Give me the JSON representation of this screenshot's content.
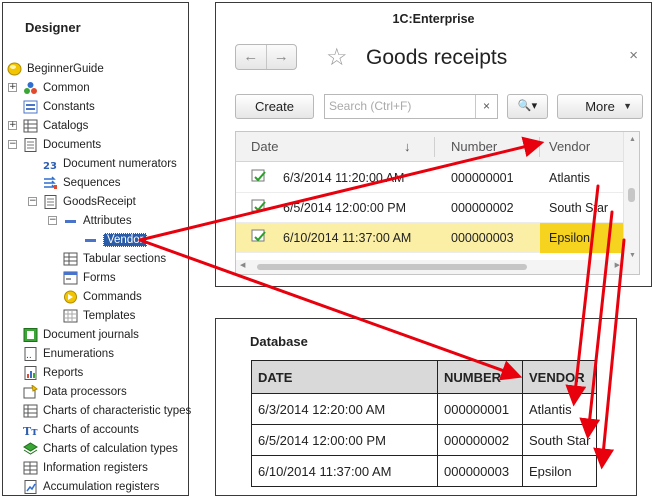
{
  "designer": {
    "title": "Designer",
    "tree": [
      {
        "label": "BeginnerGuide",
        "icon": "config-icon"
      },
      {
        "label": "Common",
        "icon": "common-icon",
        "expander": "+"
      },
      {
        "label": "Constants",
        "icon": "constants-icon"
      },
      {
        "label": "Catalogs",
        "icon": "catalogs-icon",
        "expander": "+"
      },
      {
        "label": "Documents",
        "icon": "documents-icon",
        "expander": "−"
      },
      {
        "label": "Document numerators",
        "icon": "numerator-icon"
      },
      {
        "label": "Sequences",
        "icon": "sequences-icon"
      },
      {
        "label": "GoodsReceipt",
        "icon": "document-icon",
        "expander": "−"
      },
      {
        "label": "Attributes",
        "icon": "attributes-icon",
        "expander": "−"
      },
      {
        "label": "Vendor",
        "icon": "attribute-icon"
      },
      {
        "label": "Tabular sections",
        "icon": "tabular-icon"
      },
      {
        "label": "Forms",
        "icon": "forms-icon"
      },
      {
        "label": "Commands",
        "icon": "commands-icon"
      },
      {
        "label": "Templates",
        "icon": "templates-icon"
      },
      {
        "label": "Document journals",
        "icon": "journals-icon"
      },
      {
        "label": "Enumerations",
        "icon": "enumerations-icon"
      },
      {
        "label": "Reports",
        "icon": "reports-icon"
      },
      {
        "label": "Data processors",
        "icon": "processors-icon"
      },
      {
        "label": "Charts of characteristic types",
        "icon": "char-types-icon"
      },
      {
        "label": "Charts of accounts",
        "icon": "accounts-icon"
      },
      {
        "label": "Charts of calculation types",
        "icon": "calc-types-icon"
      },
      {
        "label": "Information registers",
        "icon": "info-registers-icon"
      },
      {
        "label": "Accumulation registers",
        "icon": "accum-registers-icon"
      }
    ]
  },
  "enterprise": {
    "window_title": "1C:Enterprise",
    "form_title": "Goods receipts",
    "back_icon": "←",
    "forward_icon": "→",
    "star_icon": "☆",
    "close_icon": "×",
    "create_label": "Create",
    "search_placeholder": "Search (Ctrl+F)",
    "search_clear_icon": "×",
    "search_button_icon": "🔍▾",
    "more_label": "More",
    "more_arrow": "▼",
    "columns": {
      "date": "Date",
      "sort_icon": "↓",
      "number": "Number",
      "vendor": "Vendor"
    },
    "rows": [
      {
        "date": "6/3/2014 11:20:00 AM",
        "number": "000000001",
        "vendor": "Atlantis"
      },
      {
        "date": "6/5/2014 12:00:00 PM",
        "number": "000000002",
        "vendor": "South Star"
      },
      {
        "date": "6/10/2014 11:37:00 AM",
        "number": "000000003",
        "vendor": "Epsilon"
      }
    ],
    "colors": {
      "selected_row": "#fbefa6",
      "selected_cell": "#f6d31f"
    }
  },
  "database": {
    "title": "Database",
    "headers": [
      "DATE",
      "NUMBER",
      "VENDOR"
    ],
    "rows": [
      [
        "6/3/2014 12:20:00 AM",
        "000000001",
        "Atlantis"
      ],
      [
        "6/5/2014 12:00:00 PM",
        "000000002",
        "South Star"
      ],
      [
        "6/10/2014 11:37:00 AM",
        "000000003",
        "Epsilon"
      ]
    ]
  },
  "arrow_color": "#e8000d"
}
